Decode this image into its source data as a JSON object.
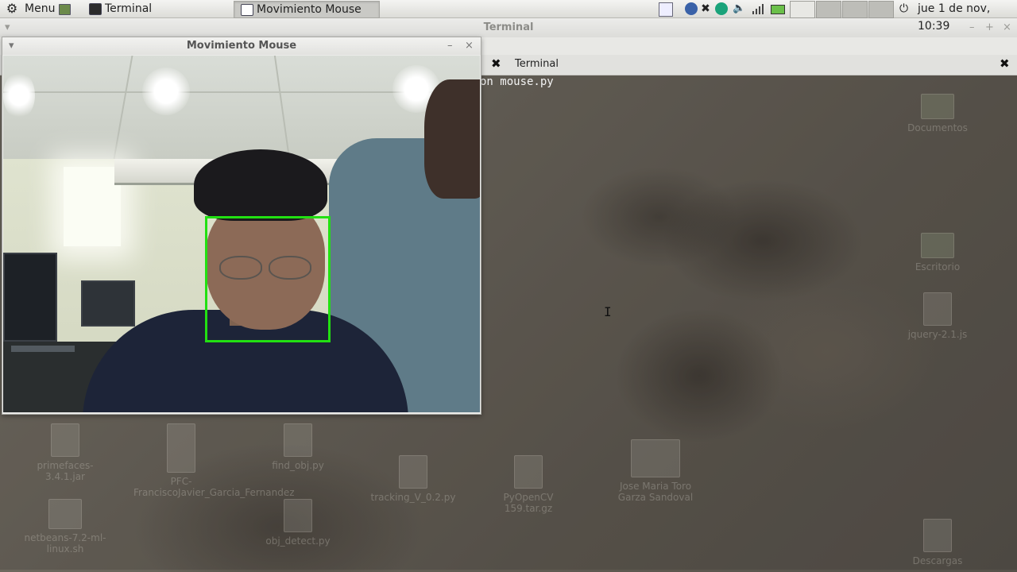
{
  "panel": {
    "menu_label": "Menu",
    "tasks": [
      {
        "label": "Terminal",
        "active": false
      },
      {
        "label": "Movimiento Mouse",
        "active": true
      }
    ],
    "clock": "jue  1 de nov, 10:39"
  },
  "terminal_window": {
    "title": "Terminal",
    "tab_label": "Terminal",
    "visible_text": "on mouse.py"
  },
  "mouse_window": {
    "title": "Movimiento Mouse",
    "face_box_color": "#22e012"
  },
  "desktop": {
    "icons": [
      "jquery-2.1.js",
      "primefaces-3.4.1.jar",
      "PFC-FranciscoJavier_Garcia_Fernandez",
      "find_obj.py",
      "netbeans-7.2-ml-linux.sh",
      "obj_detect.py",
      "tracking_V_0.2.py",
      "PyOpenCV 159.tar.gz",
      "Jose Maria Toro Garza Sandoval",
      "Documentos",
      "Escritorio",
      "Descargas"
    ]
  }
}
